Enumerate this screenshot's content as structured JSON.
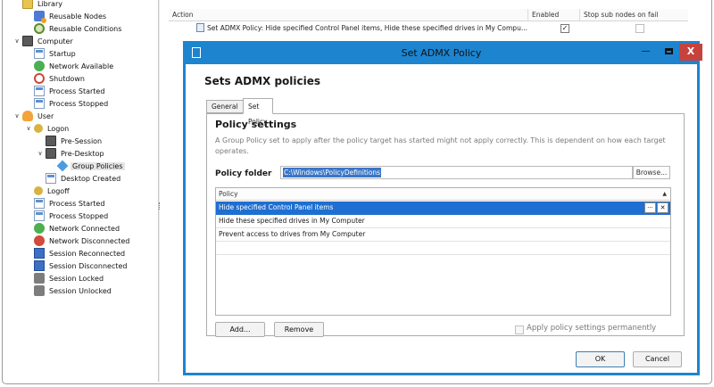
{
  "tree": {
    "items": [
      {
        "label": "Library",
        "level": 0,
        "toggle": "",
        "icon": "folder-icon"
      },
      {
        "label": "Reusable Nodes",
        "level": 1,
        "toggle": "",
        "icon": "nodes-icon"
      },
      {
        "label": "Reusable Conditions",
        "level": 1,
        "toggle": "",
        "icon": "conditions-icon"
      },
      {
        "label": "Computer",
        "level": 0,
        "toggle": "∨",
        "icon": "computer-icon"
      },
      {
        "label": "Startup",
        "level": 1,
        "toggle": "",
        "icon": "startup-icon"
      },
      {
        "label": "Network Available",
        "level": 1,
        "toggle": "",
        "icon": "network-available-icon"
      },
      {
        "label": "Shutdown",
        "level": 1,
        "toggle": "",
        "icon": "shutdown-icon"
      },
      {
        "label": "Process Started",
        "level": 1,
        "toggle": "",
        "icon": "process-started-icon"
      },
      {
        "label": "Process Stopped",
        "level": 1,
        "toggle": "",
        "icon": "process-stopped-icon"
      },
      {
        "label": "User",
        "level": 0,
        "toggle": "∨",
        "icon": "user-icon"
      },
      {
        "label": "Logon",
        "level": 1,
        "toggle": "∨",
        "icon": "logon-icon"
      },
      {
        "label": "Pre-Session",
        "level": 2,
        "toggle": "",
        "icon": "pre-session-icon"
      },
      {
        "label": "Pre-Desktop",
        "level": 2,
        "toggle": "∨",
        "icon": "pre-desktop-icon"
      },
      {
        "label": "Group Policies",
        "level": 3,
        "toggle": "",
        "icon": "group-policies-icon",
        "selected": true
      },
      {
        "label": "Desktop Created",
        "level": 2,
        "toggle": "",
        "icon": "desktop-created-icon"
      },
      {
        "label": "Logoff",
        "level": 1,
        "toggle": "",
        "icon": "logoff-icon"
      },
      {
        "label": "Process Started",
        "level": 1,
        "toggle": "",
        "icon": "process-started-icon"
      },
      {
        "label": "Process Stopped",
        "level": 1,
        "toggle": "",
        "icon": "process-stopped-icon"
      },
      {
        "label": "Network Connected",
        "level": 1,
        "toggle": "",
        "icon": "network-connected-icon"
      },
      {
        "label": "Network Disconnected",
        "level": 1,
        "toggle": "",
        "icon": "network-disconnected-icon"
      },
      {
        "label": "Session Reconnected",
        "level": 1,
        "toggle": "",
        "icon": "session-reconnected-icon"
      },
      {
        "label": "Session Disconnected",
        "level": 1,
        "toggle": "",
        "icon": "session-disconnected-icon"
      },
      {
        "label": "Session Locked",
        "level": 1,
        "toggle": "",
        "icon": "session-locked-icon"
      },
      {
        "label": "Session Unlocked",
        "level": 1,
        "toggle": "",
        "icon": "session-unlocked-icon"
      }
    ]
  },
  "grid": {
    "columns": {
      "action": "Action",
      "enabled": "Enabled",
      "stop": "Stop sub nodes on fail"
    },
    "row": {
      "action": "Set ADMX Policy: Hide specified Control Panel items, Hide these specified drives in My Compu...",
      "enabled": true,
      "stop": false
    }
  },
  "dialog": {
    "title": "Set ADMX Policy",
    "heading": "Sets ADMX policies",
    "tabs": [
      {
        "label": "General",
        "active": false
      },
      {
        "label": "Set Policy",
        "active": true
      }
    ],
    "policy_settings_title": "Policy settings",
    "description": "A Group Policy set to apply after the policy target has started might not apply correctly. This is dependent on how each target operates.",
    "policy_folder_label": "Policy folder",
    "policy_folder_value": "C:\\Windows\\PolicyDefinitions",
    "browse_label": "Browse...",
    "list": {
      "header": "Policy",
      "sort_glyph": "▲",
      "rows": [
        {
          "text": "Hide specified Control Panel items",
          "selected": true
        },
        {
          "text": "Hide these specified drives in My Computer",
          "selected": false
        },
        {
          "text": "Prevent access to drives from My Computer",
          "selected": false
        }
      ],
      "row_edit_glyph": "···",
      "row_delete_glyph": "✕"
    },
    "add_label": "Add...",
    "remove_label": "Remove",
    "apply_permanently_label": "Apply policy settings permanently",
    "apply_permanently_checked": false,
    "ok_label": "OK",
    "cancel_label": "Cancel",
    "title_buttons": {
      "minimize": "—",
      "close": "X"
    }
  },
  "colors": {
    "accent": "#1d84cf",
    "selection": "#1e6fd1",
    "close": "#c6423d"
  }
}
